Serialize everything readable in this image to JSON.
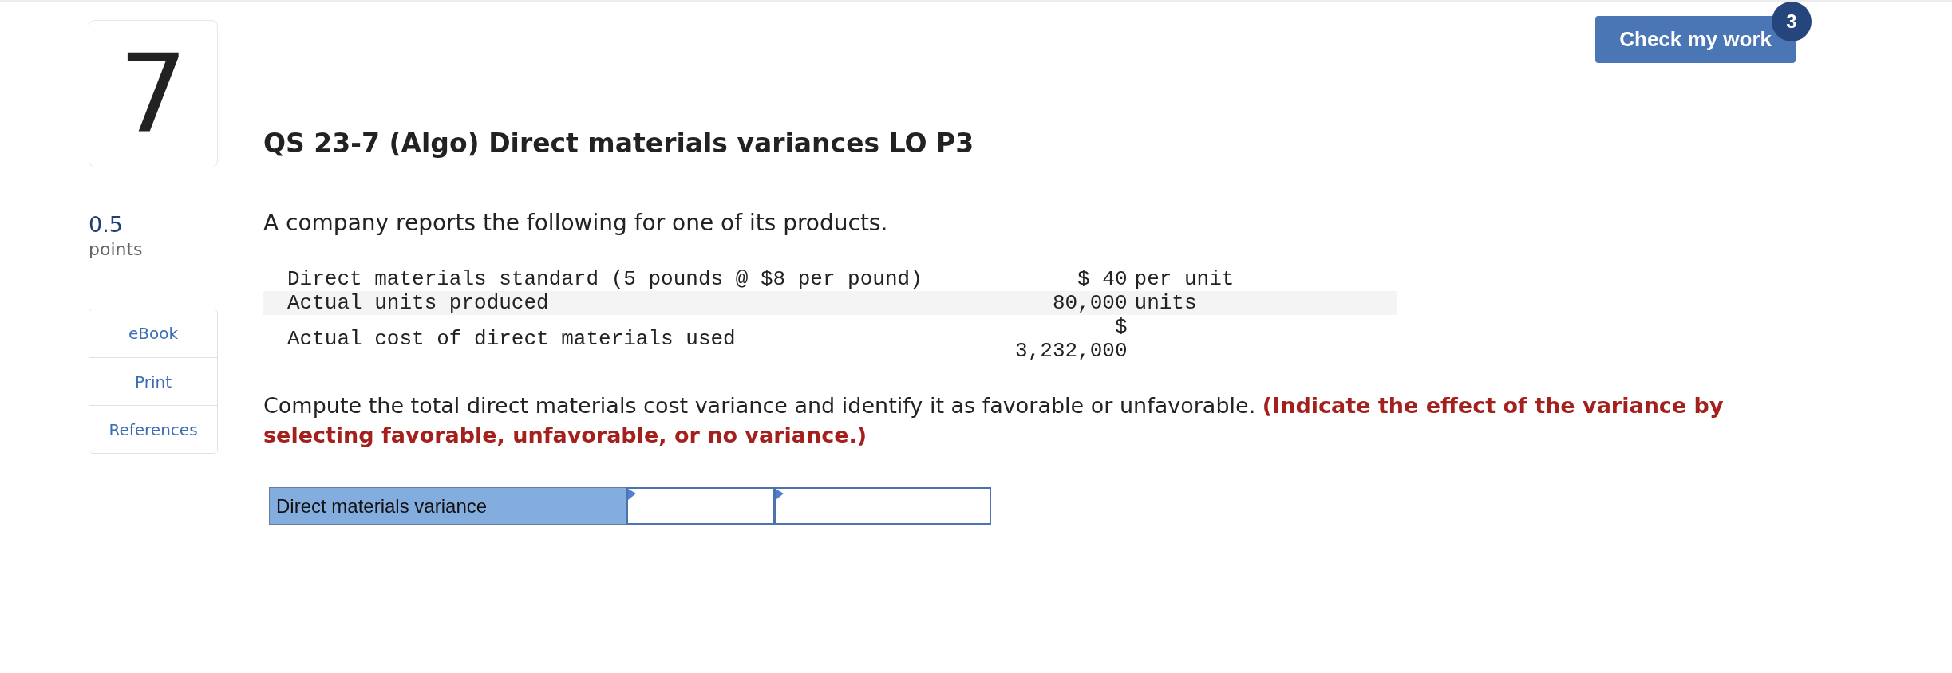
{
  "check_button": {
    "label": "Check my work",
    "badge": "3"
  },
  "question": {
    "number": "7",
    "points": "0.5",
    "points_label": "points",
    "title": "QS 23-7 (Algo) Direct materials variances LO P3"
  },
  "resources": [
    "eBook",
    "Print",
    "References"
  ],
  "intro": "A company reports the following for one of its products.",
  "data_table": {
    "rows": [
      {
        "label": "Direct materials standard (5 pounds @ $8 per pound)",
        "value": "$ 40",
        "unit": "per unit"
      },
      {
        "label": "Actual units produced",
        "value": "80,000",
        "unit": "units"
      },
      {
        "label": "Actual cost of direct materials used",
        "value": "$ 3,232,000"
      }
    ]
  },
  "instruction": "Compute the total direct materials cost variance and identify it as favorable or unfavorable. **(Indicate the effect of the variance by selecting favorable, unfavorable, or no variance.)**",
  "answer_row": {
    "label": "Direct materials variance",
    "fields": [
      {
        "kind": "entry"
      },
      {
        "kind": "entry"
      }
    ]
  }
}
